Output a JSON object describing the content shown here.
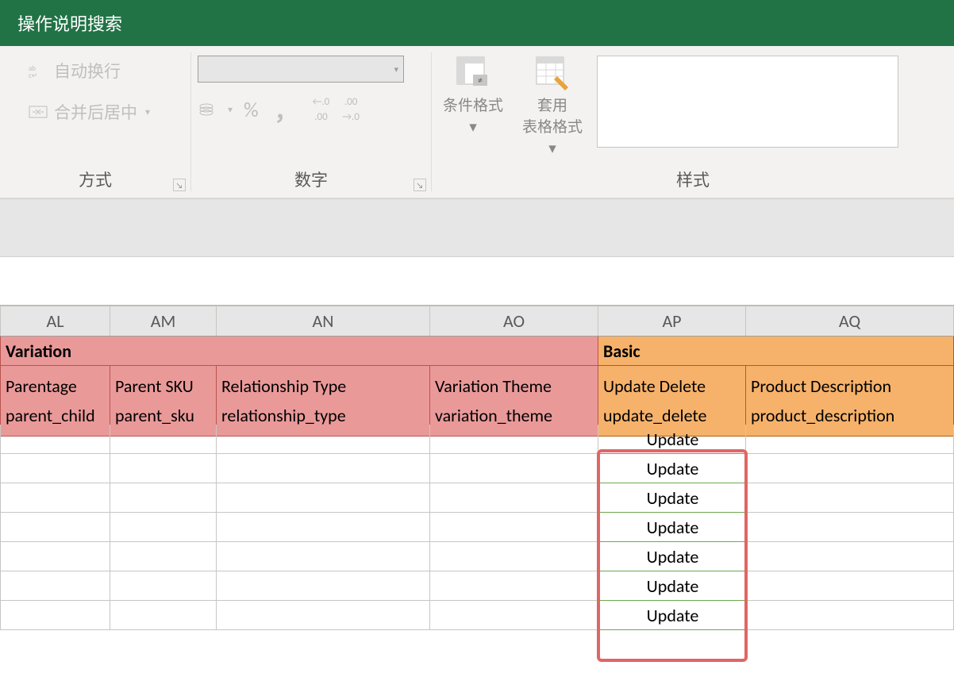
{
  "titlebar": {
    "search": "操作说明搜索"
  },
  "ribbon": {
    "alignment": {
      "wrap": "自动换行",
      "merge": "合并后居中",
      "group_label": "方式"
    },
    "number": {
      "group_label": "数字",
      "percent": "%",
      "comma": "，",
      "inc_dec": "←.0",
      "inc_dec2": ".00",
      "dec_inc": ".00",
      "dec_inc2": "→.0"
    },
    "styles": {
      "group_label": "样式",
      "cond_fmt": "条件格式",
      "table_fmt": "套用\n表格格式"
    }
  },
  "columns": [
    "AL",
    "AM",
    "AN",
    "AO",
    "AP",
    "AQ"
  ],
  "sections": {
    "variation": "Variation",
    "basic": "Basic"
  },
  "headers1": [
    "Parentage",
    "Parent SKU",
    "Relationship Type",
    "Variation Theme",
    "Update Delete",
    "Product Description"
  ],
  "headers2": [
    "parent_child",
    "parent_sku",
    "relationship_type",
    "variation_theme",
    "update_delete",
    "product_description"
  ],
  "rows": [
    [
      "",
      "",
      "",
      "",
      "Update",
      ""
    ],
    [
      "",
      "",
      "",
      "",
      "Update",
      ""
    ],
    [
      "",
      "",
      "",
      "",
      "Update",
      ""
    ],
    [
      "",
      "",
      "",
      "",
      "Update",
      ""
    ],
    [
      "",
      "",
      "",
      "",
      "Update",
      ""
    ],
    [
      "",
      "",
      "",
      "",
      "Update",
      ""
    ],
    [
      "",
      "",
      "",
      "",
      "Update",
      ""
    ]
  ]
}
